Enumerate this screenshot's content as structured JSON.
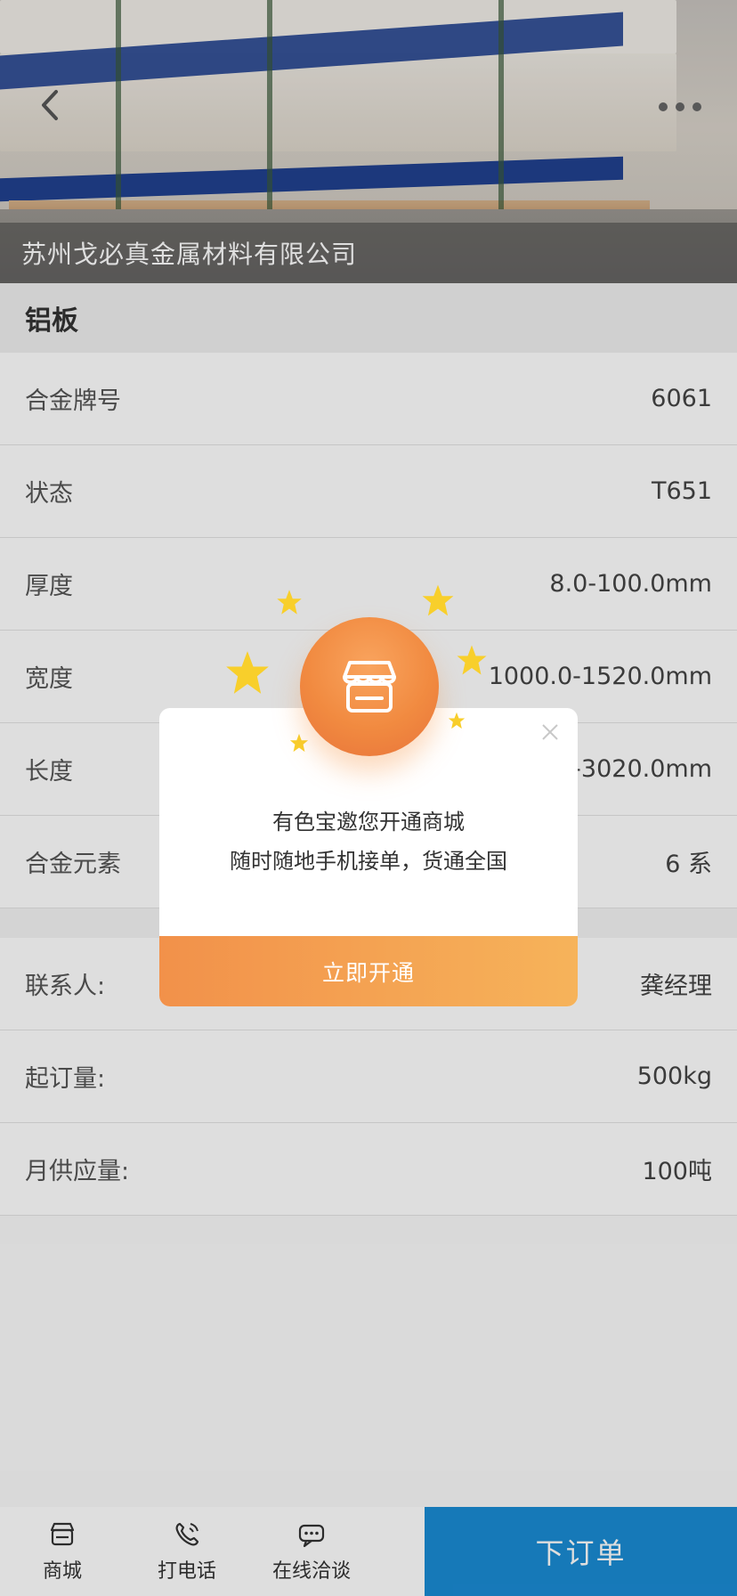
{
  "header": {
    "company_name": "苏州戈必真金属材料有限公司",
    "back_icon": "chevron-left-icon",
    "more_icon": "more-dots-icon"
  },
  "product": {
    "title": "铝板"
  },
  "specs": [
    {
      "label": "合金牌号",
      "value": "6061"
    },
    {
      "label": "状态",
      "value": "T651"
    },
    {
      "label": "厚度",
      "value": "8.0-100.0mm"
    },
    {
      "label": "宽度",
      "value": "1000.0-1520.0mm"
    },
    {
      "label": "长度",
      "value": "-3020.0mm"
    },
    {
      "label": "合金元素",
      "value": "6 系"
    }
  ],
  "contact": [
    {
      "label": "联系人:",
      "value": "龚经理"
    },
    {
      "label": "起订量:",
      "value": "500kg"
    },
    {
      "label": "月供应量:",
      "value": "100吨"
    }
  ],
  "bottom_bar": {
    "tabs": [
      {
        "label": "商城",
        "icon": "store-icon"
      },
      {
        "label": "打电话",
        "icon": "phone-icon"
      },
      {
        "label": "在线洽谈",
        "icon": "chat-icon"
      }
    ],
    "order_label": "下订单"
  },
  "modal": {
    "line1": "有色宝邀您开通商城",
    "line2": "随时随地手机接单，货通全国",
    "button_label": "立即开通",
    "badge_icon": "store-icon",
    "close_icon": "close-icon"
  },
  "colors": {
    "accent_blue": "#1a8bd4",
    "modal_orange": "#f2914a",
    "star_yellow": "#f8cf2b"
  }
}
